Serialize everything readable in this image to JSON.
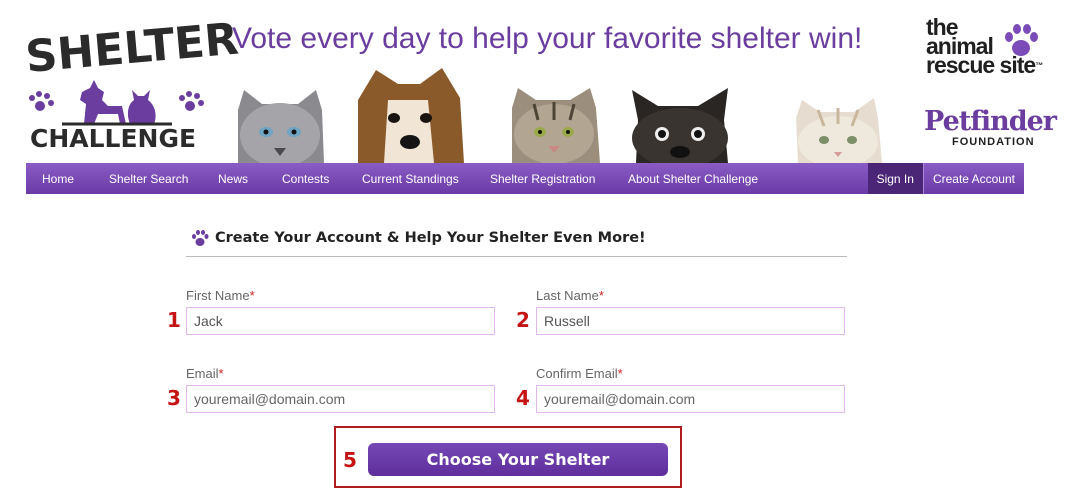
{
  "header": {
    "logo_top": "SHELTER",
    "logo_bottom": "CHALLENGE",
    "tagline": "Vote every day to help your favorite shelter win!",
    "partner_logo_lines": [
      "the",
      "animal",
      "rescue site"
    ],
    "partner_trademark": "™",
    "foundation_name": "Petfinder",
    "foundation_sub": "FOUNDATION"
  },
  "nav": {
    "items": [
      {
        "label": "Home"
      },
      {
        "label": "Shelter Search"
      },
      {
        "label": "News"
      },
      {
        "label": "Contests"
      },
      {
        "label": "Current Standings"
      },
      {
        "label": "Shelter Registration"
      },
      {
        "label": "About Shelter Challenge"
      }
    ],
    "sign_in": "Sign In",
    "create_account": "Create Account"
  },
  "form": {
    "title": "Create Your Account & Help Your Shelter Even More!",
    "required_mark": "*",
    "first_name": {
      "label": "First Name",
      "value": "Jack",
      "step": "1"
    },
    "last_name": {
      "label": "Last Name",
      "value": "Russell",
      "step": "2"
    },
    "email": {
      "label": "Email",
      "placeholder": "youremail@domain.com",
      "step": "3"
    },
    "confirm_email": {
      "label": "Confirm Email",
      "placeholder": "youremail@domain.com",
      "step": "4"
    },
    "submit": {
      "label": "Choose Your Shelter",
      "step": "5"
    }
  },
  "colors": {
    "brand_purple": "#6a3d9e",
    "nav_purple": "#7a4ab6",
    "step_red": "#c41414"
  }
}
